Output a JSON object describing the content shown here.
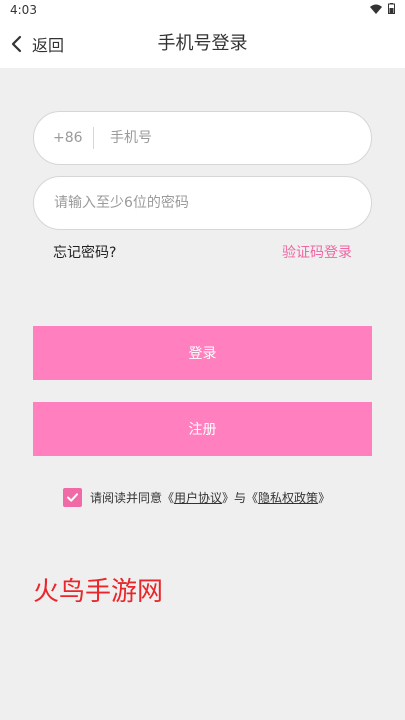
{
  "status_bar": {
    "time": "4:03"
  },
  "nav": {
    "back_label": "返回",
    "title": "手机号登录"
  },
  "form": {
    "phone_prefix": "+86",
    "phone_placeholder": "手机号",
    "password_placeholder": "请输入至少6位的密码",
    "forgot_label": "忘记密码?",
    "sms_login_label": "验证码登录",
    "login_label": "登录",
    "register_label": "注册"
  },
  "agreement": {
    "checked": true,
    "text_before": "请阅读并同意《",
    "user_agreement": "用户协议",
    "text_middle": "》与《",
    "privacy_policy": "隐私权政策",
    "text_after": "》"
  },
  "watermark": "火鸟手游网",
  "colors": {
    "accent": "#ff7fbf",
    "link_pink": "#f066a4",
    "checkbox": "#f06aa7",
    "watermark": "#e8262b"
  }
}
